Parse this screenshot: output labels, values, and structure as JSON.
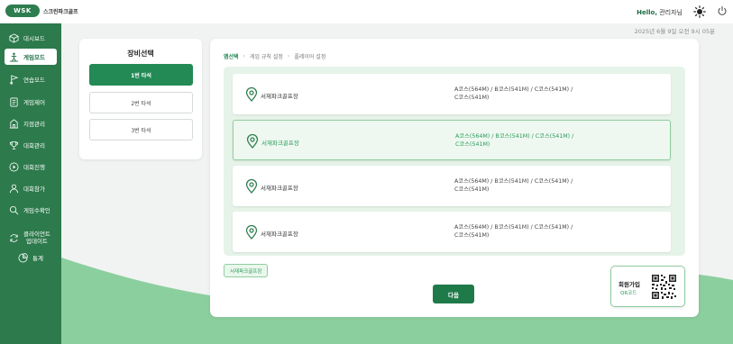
{
  "header": {
    "logo_mark": "WSK",
    "app_title": "스크린파크골프",
    "greeting_prefix": "Hello,",
    "greeting_user": "관리자님"
  },
  "datetime": "2025년 6월 9일 오전 9시 05분",
  "sidebar": {
    "items": [
      {
        "label": "대시보드",
        "icon": "cube-icon"
      },
      {
        "label": "게임모드",
        "icon": "golfer-icon",
        "active": true
      },
      {
        "label": "연습모드",
        "icon": "flag-icon"
      },
      {
        "label": "게임제어",
        "icon": "document-icon"
      },
      {
        "label": "지점관리",
        "icon": "building-icon"
      },
      {
        "label": "대회관리",
        "icon": "trophy-icon"
      },
      {
        "label": "대회진행",
        "icon": "play-icon"
      },
      {
        "label": "대회참가",
        "icon": "person-icon"
      },
      {
        "label": "게임수확인",
        "icon": "search-icon"
      },
      {
        "label_line1": "클라이언트",
        "label_line2": "업데이트",
        "icon": "refresh-icon"
      },
      {
        "label": "통계",
        "icon": "chart-icon"
      }
    ]
  },
  "equipment": {
    "title": "장비선택",
    "options": [
      "1번 타석",
      "2번 타석",
      "3번 타석"
    ],
    "selected": "1번 타석"
  },
  "breadcrumb": [
    "맵선택",
    "게임 규칙 설정",
    "플레이어 설정"
  ],
  "courses": [
    {
      "name": "서재파크골프장",
      "line1": "A코스(564M) / B코스(541M) / C코스(541M) /",
      "line2": "C코스(541M)"
    },
    {
      "name": "서재파크골프장",
      "line1": "A코스(564M) / B코스(541M) / C코스(541M) /",
      "line2": "C코스(541M)",
      "selected": true
    },
    {
      "name": "서재파크골프장",
      "line1": "A코스(564M) / B코스(541M) / C코스(541M) /",
      "line2": "C코스(541M)"
    },
    {
      "name": "서재파크골프장",
      "line1": "A코스(564M) / B코스(541M) / C코스(541M) /",
      "line2": "C코스(541M)"
    }
  ],
  "selected_chip": "서재파크골프장",
  "next_label": "다음",
  "signup": {
    "title": "회원가입",
    "subtitle": "QR코드"
  },
  "colors": {
    "brand_green": "#2d7a4c",
    "accent_green": "#238a55",
    "light_green": "#e6f3e9"
  }
}
